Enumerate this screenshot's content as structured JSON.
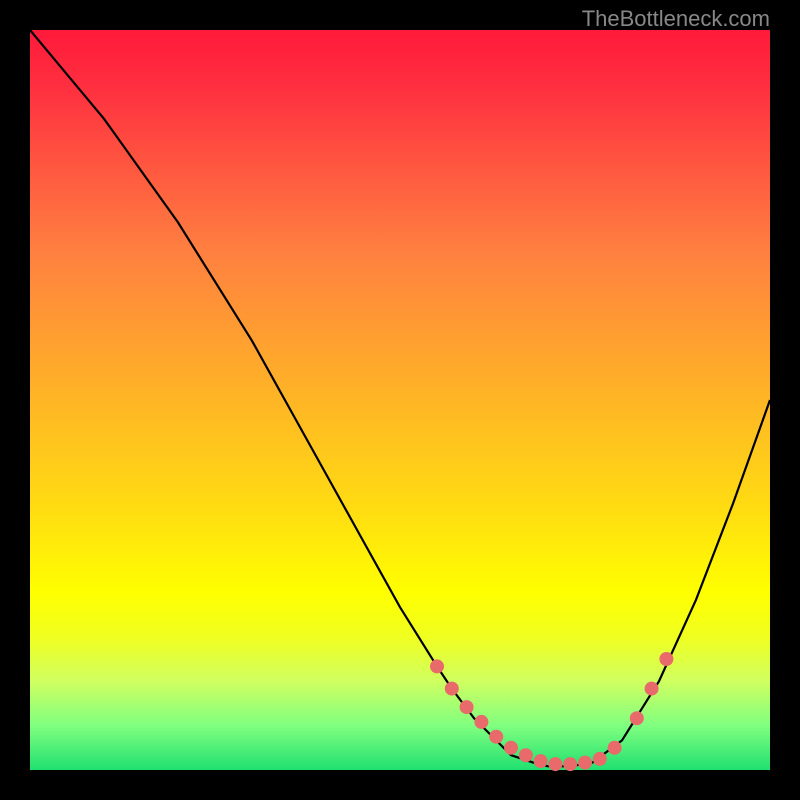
{
  "watermark": "TheBottleneck.com",
  "chart_data": {
    "type": "line",
    "title": "",
    "xlabel": "",
    "ylabel": "",
    "xlim": [
      0,
      100
    ],
    "ylim": [
      0,
      100
    ],
    "background_gradient": {
      "top": "#ff1a3a",
      "bottom": "#20e070"
    },
    "series": [
      {
        "name": "bottleneck-curve",
        "color": "#000000",
        "x": [
          0,
          5,
          10,
          15,
          20,
          25,
          30,
          35,
          40,
          45,
          50,
          55,
          57,
          60,
          63,
          65,
          68,
          70,
          73,
          76,
          80,
          85,
          90,
          95,
          100
        ],
        "y": [
          100,
          94,
          88,
          81,
          74,
          66,
          58,
          49,
          40,
          31,
          22,
          14,
          11,
          7,
          4,
          2,
          1,
          0.5,
          0.5,
          1,
          4,
          12,
          23,
          36,
          50
        ]
      }
    ],
    "markers": {
      "name": "highlight-dots",
      "color": "#e86a6a",
      "radius_px": 7,
      "x": [
        55,
        57,
        59,
        61,
        63,
        65,
        67,
        69,
        71,
        73,
        75,
        77,
        79,
        82,
        84,
        86
      ],
      "y": [
        14,
        11,
        8.5,
        6.5,
        4.5,
        3,
        2,
        1.2,
        0.8,
        0.8,
        1,
        1.5,
        3,
        7,
        11,
        15
      ]
    }
  }
}
